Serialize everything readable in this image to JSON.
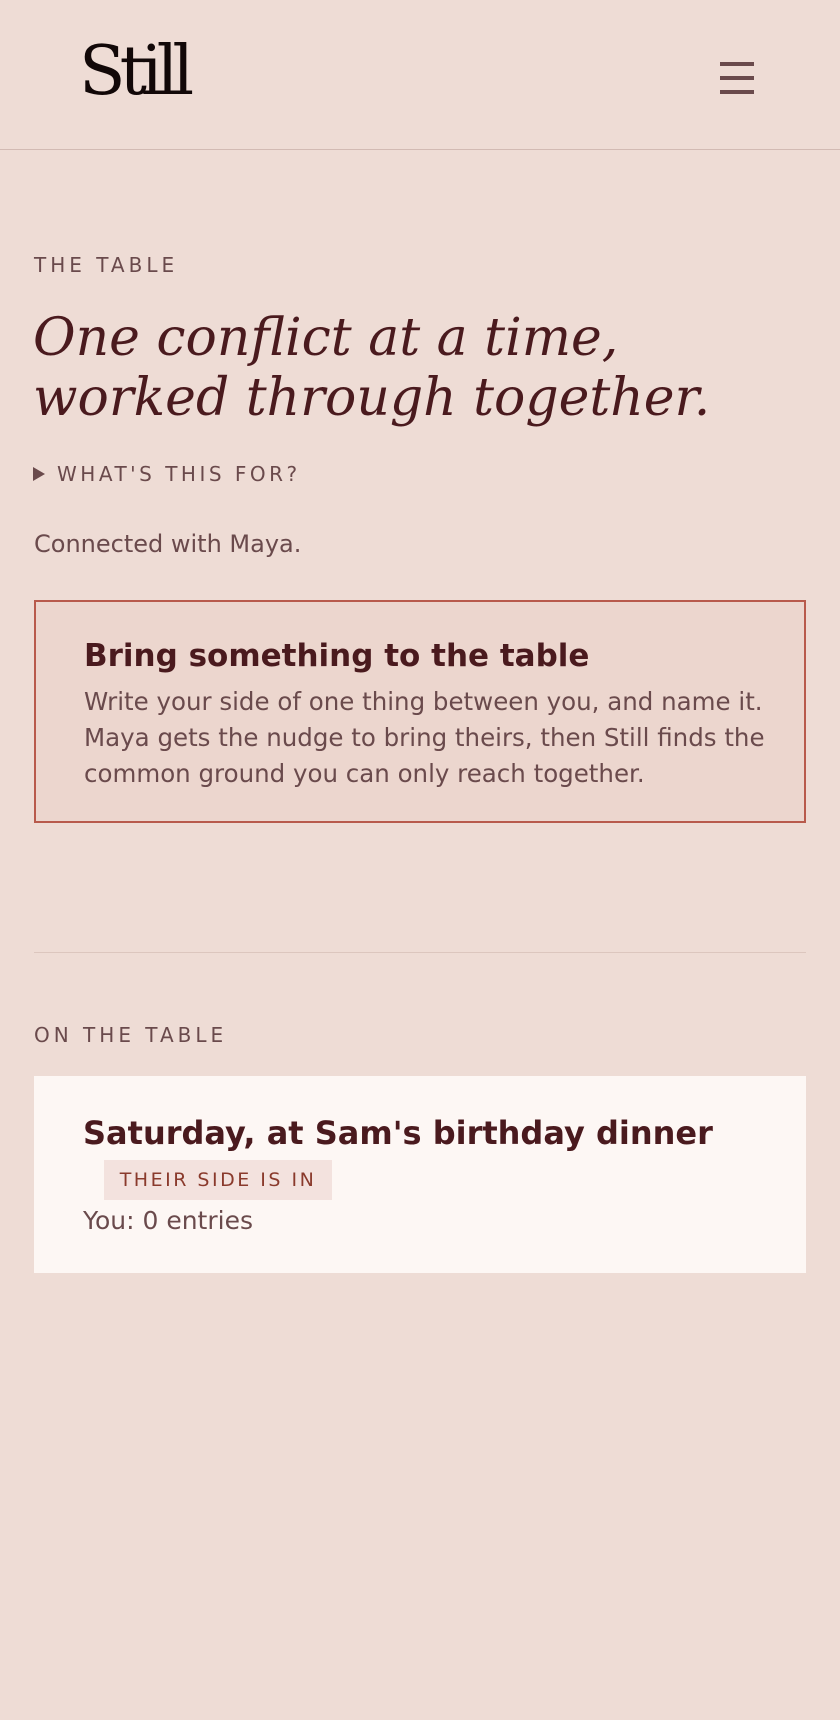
{
  "header": {
    "logo_text": "Still",
    "menu_icon": "hamburger-menu-icon"
  },
  "intro": {
    "eyebrow": "THE TABLE",
    "headline": "One conflict at a time, worked through together.",
    "disclosure_label": "WHAT'S THIS FOR?",
    "connected_text": "Connected with Maya."
  },
  "bring_card": {
    "title": "Bring something to the table",
    "body": "Write your side of one thing between you, and name it. Maya gets the nudge to bring theirs, then Still finds the common ground you can only reach together."
  },
  "on_table": {
    "eyebrow": "ON THE TABLE",
    "items": [
      {
        "title": "Saturday, at Sam's birthday dinner",
        "badge": "THEIR SIDE IS IN",
        "entries": "You: 0 entries"
      }
    ]
  },
  "colors": {
    "background": "#eedcd5",
    "accent_border": "#b85a4c",
    "text_primary": "#4a1a1e",
    "text_secondary": "#6a4a4c",
    "card_background": "#fdf7f4",
    "badge_background": "#f3e2de",
    "badge_text": "#8a3a2c"
  }
}
